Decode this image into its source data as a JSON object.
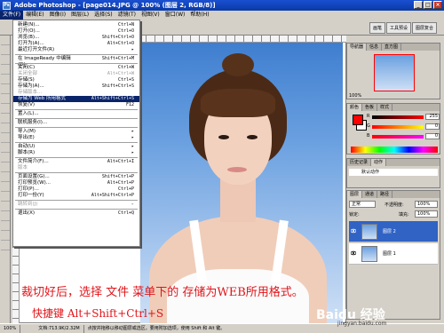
{
  "app": {
    "title": "Adobe Photoshop - [page014.JPG @ 100% (图层 2, RGB/8)]",
    "icon": "Ps"
  },
  "window_buttons": {
    "minimize": "_",
    "maximize": "□",
    "close": "×"
  },
  "menubar": [
    {
      "label": "文件(F)",
      "active": true
    },
    {
      "label": "编辑(E)"
    },
    {
      "label": "图像(I)"
    },
    {
      "label": "图层(L)"
    },
    {
      "label": "选择(S)"
    },
    {
      "label": "滤镜(T)"
    },
    {
      "label": "视图(V)"
    },
    {
      "label": "窗口(W)"
    },
    {
      "label": "帮助(H)"
    }
  ],
  "options_tabs": [
    "画笔",
    "工具预设",
    "图层复合"
  ],
  "file_menu": [
    {
      "label": "新建(N)...",
      "shortcut": "Ctrl+N"
    },
    {
      "label": "打开(O)...",
      "shortcut": "Ctrl+O"
    },
    {
      "label": "浏览(B)...",
      "shortcut": "Shift+Ctrl+O"
    },
    {
      "label": "打开为(A)...",
      "shortcut": "Alt+Ctrl+O"
    },
    {
      "label": "最近打开文件(R)",
      "shortcut": "▸"
    },
    {
      "sep": true
    },
    {
      "label": "在 ImageReady 中编辑(D)",
      "shortcut": "Shift+Ctrl+M"
    },
    {
      "sep": true
    },
    {
      "label": "关闭(C)",
      "shortcut": "Ctrl+W"
    },
    {
      "label": "关闭全部",
      "shortcut": "Alt+Ctrl+W",
      "disabled": true
    },
    {
      "label": "存储(S)",
      "shortcut": "Ctrl+S"
    },
    {
      "label": "存储为(A)...",
      "shortcut": "Shift+Ctrl+S"
    },
    {
      "label": "存储版本...",
      "shortcut": "",
      "disabled": true
    },
    {
      "label": "存储为 Web 所用格式(W)...",
      "shortcut": "Alt+Shift+Ctrl+S",
      "highlight": true
    },
    {
      "label": "恢复(V)",
      "shortcut": "F12"
    },
    {
      "sep": true
    },
    {
      "label": "置入(L)...",
      "shortcut": ""
    },
    {
      "sep": true
    },
    {
      "label": "联机服务(I)...",
      "shortcut": ""
    },
    {
      "sep": true
    },
    {
      "label": "导入(M)",
      "shortcut": "▸"
    },
    {
      "label": "导出(E)",
      "shortcut": "▸"
    },
    {
      "sep": true
    },
    {
      "label": "自动(U)",
      "shortcut": "▸"
    },
    {
      "label": "脚本(R)",
      "shortcut": "▸"
    },
    {
      "sep": true
    },
    {
      "label": "文件简介(F)...",
      "shortcut": "Alt+Ctrl+I"
    },
    {
      "label": "版本",
      "shortcut": "",
      "disabled": true
    },
    {
      "sep": true
    },
    {
      "label": "页面设置(G)...",
      "shortcut": "Shift+Ctrl+P"
    },
    {
      "label": "打印预览(W)...",
      "shortcut": "Alt+Ctrl+P"
    },
    {
      "label": "打印(P)...",
      "shortcut": "Ctrl+P"
    },
    {
      "label": "打印一份(Y)",
      "shortcut": "Alt+Shift+Ctrl+P"
    },
    {
      "sep": true
    },
    {
      "label": "跳转到(J)",
      "shortcut": "▸",
      "disabled": true
    },
    {
      "sep": true
    },
    {
      "label": "退出(X)",
      "shortcut": "Ctrl+Q"
    }
  ],
  "navigator": {
    "tabs": [
      "导航器",
      "信息",
      "直方图"
    ],
    "zoom": "100%"
  },
  "color_panel": {
    "tabs": [
      "颜色",
      "色板",
      "样式"
    ],
    "channels": [
      {
        "label": "R",
        "value": "255",
        "color": "#ff0000"
      },
      {
        "label": "G",
        "value": "0",
        "color": "#00ff00"
      },
      {
        "label": "B",
        "value": "0",
        "color": "#0000ff"
      }
    ],
    "foreground": "#ff0000",
    "background": "#ffffff"
  },
  "history_panel": {
    "tabs": [
      "历史记录",
      "动作"
    ],
    "row": "默认动作"
  },
  "layers_panel": {
    "tabs": [
      "图层",
      "通道",
      "路径"
    ],
    "blend_mode": "正常",
    "opacity_label": "不透明度:",
    "opacity": "100%",
    "lock_label": "锁定:",
    "fill_label": "填充:",
    "fill": "100%",
    "layers": [
      {
        "name": "图层 2",
        "selected": true
      },
      {
        "name": "图层 1",
        "selected": false
      }
    ]
  },
  "statusbar": {
    "zoom": "100%",
    "doc": "文档:713.9K/2.32M",
    "hint": "点按并拖移以移动图层或选区。要用附加选项，使用 Shift 和 Alt 键。"
  },
  "annotation": {
    "line1": "裁切好后，选择 文件 菜单下的 存储为WEB所用格式。",
    "line2": "快捷键 Alt+Shift+Ctrl+S"
  },
  "watermark": {
    "main": "Baidu 经验",
    "sub": "jingyan.baidu.com"
  }
}
